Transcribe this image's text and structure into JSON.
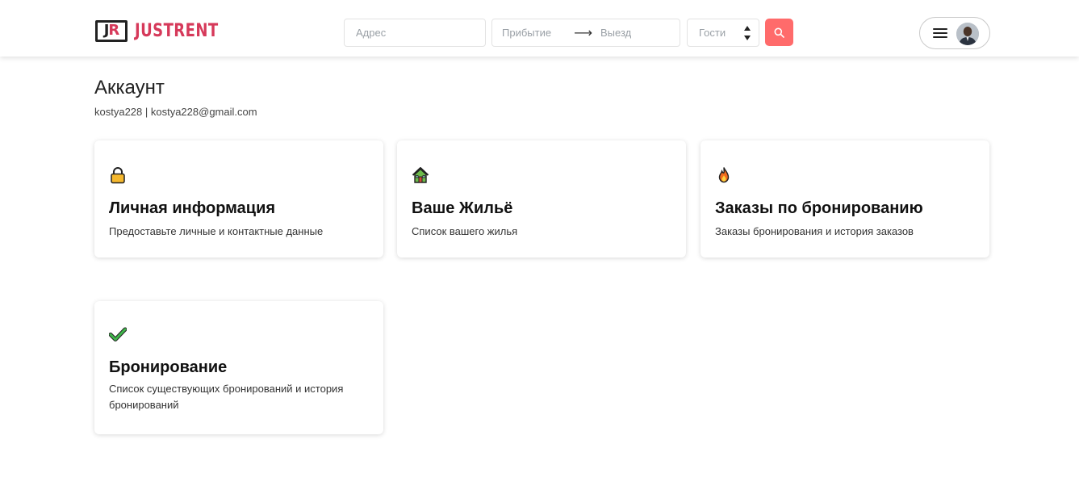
{
  "header": {
    "logo_mark_j": "J",
    "logo_mark_r": "R",
    "logo_text": "JUSTRENT",
    "address_placeholder": "Адрес",
    "arrival_placeholder": "Прибытие",
    "departure_placeholder": "Выезд",
    "guests_placeholder": "Гости",
    "accent_color": "#d6395a",
    "search_button_color": "#ff6b6b"
  },
  "account": {
    "title": "Аккаунт",
    "user_line": "kostya228 | kostya228@gmail.com"
  },
  "cards": [
    {
      "icon": "lock-icon",
      "title": "Личная информация",
      "description": "Предоставьте личные и контактные данные"
    },
    {
      "icon": "house-icon",
      "title": "Ваше Жильё",
      "description": "Список вашего жилья"
    },
    {
      "icon": "fire-icon",
      "title": "Заказы по бронированию",
      "description": "Заказы бронирования и история заказов"
    },
    {
      "icon": "checkmark-icon",
      "title": "Бронирование",
      "description": "Список существующих бронирований и история бронирований"
    }
  ]
}
